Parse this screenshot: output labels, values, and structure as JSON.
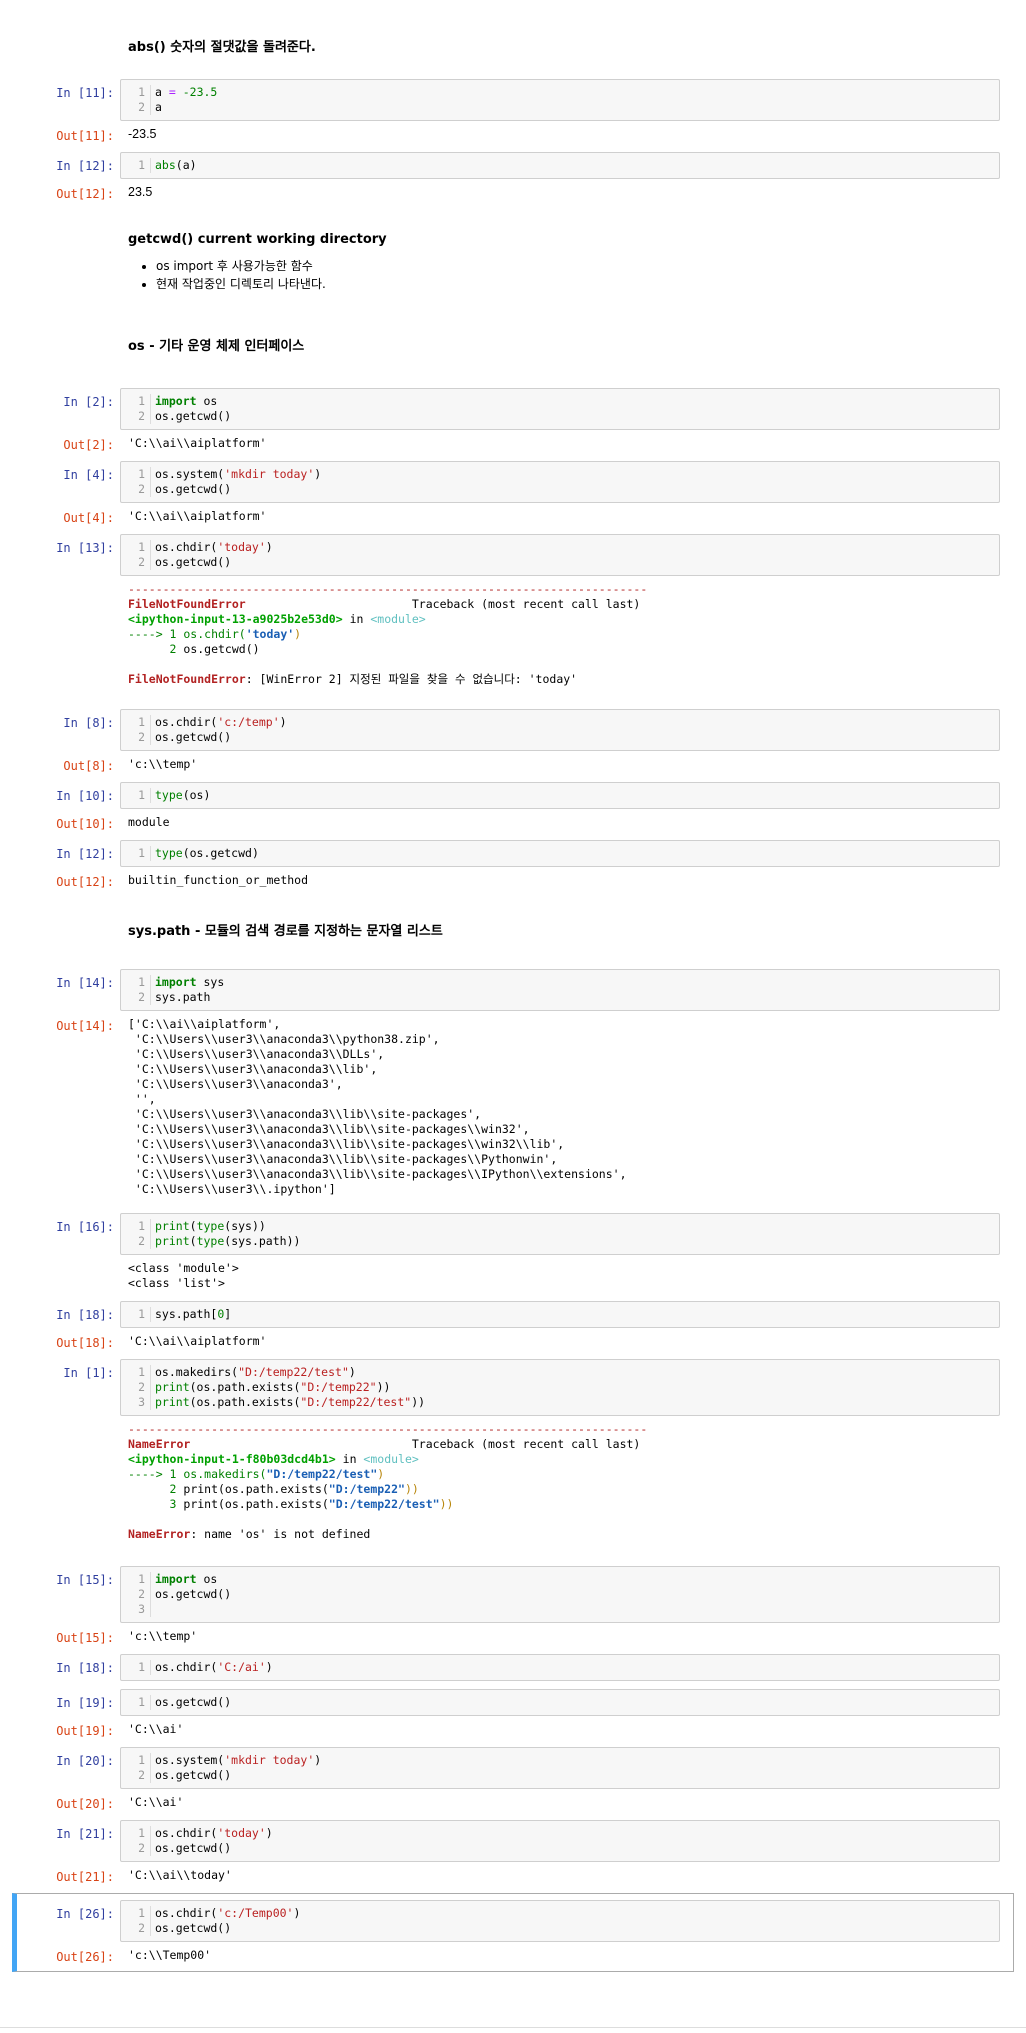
{
  "markdown": {
    "abs_heading": "abs() 숫자의 절댓값을 돌려준다.",
    "getcwd_heading": "getcwd() current working directory",
    "getcwd_bullets": [
      "os import 후 사용가능한 함수",
      "현재 작업중인 디렉토리 나타낸다."
    ],
    "os_heading": "os - 기타 운영 체제 인터페이스",
    "syspath_heading": "sys.path - 모듈의 검색 경로를 지정하는 문자열 리스트"
  },
  "cells": {
    "c11": {
      "in": "In [11]:",
      "out": "Out[11]:",
      "result": "-23.5",
      "gutter": "1\n2"
    },
    "c12a": {
      "in": "In [12]:",
      "out": "Out[12]:",
      "result": "23.5",
      "gutter": "1"
    },
    "c2": {
      "in": "In [2]:",
      "out": "Out[2]:",
      "result": "'C:\\\\ai\\\\aiplatform'",
      "gutter": "1\n2"
    },
    "c4": {
      "in": "In [4]:",
      "out": "Out[4]:",
      "result": "'C:\\\\ai\\\\aiplatform'",
      "gutter": "1\n2"
    },
    "c13": {
      "in": "In [13]:",
      "gutter": "1\n2",
      "dashes": "---------------------------------------------------------------------------",
      "err_name": "FileNotFoundError",
      "traceback_label": "Traceback (most recent call last)",
      "input_ref": "<ipython-input-13-a9025b2e53d0>",
      "in_word": " in ",
      "module_ref": "<module>",
      "arrow_line_prefix": "----> 1 os.chdir(",
      "arrow_line_str": "'today'",
      "arrow_line_suffix": ")",
      "line2_num": "      2 ",
      "line2_code": "os.getcwd()",
      "err_final_name": "FileNotFoundError",
      "err_final_msg": ": [WinError 2] 지정된 파일을 찾을 수 없습니다: 'today'"
    },
    "c8": {
      "in": "In [8]:",
      "out": "Out[8]:",
      "result": "'c:\\\\temp'",
      "gutter": "1\n2"
    },
    "c10": {
      "in": "In [10]:",
      "out": "Out[10]:",
      "result": "module",
      "gutter": "1"
    },
    "c12b": {
      "in": "In [12]:",
      "out": "Out[12]:",
      "result": "builtin_function_or_method",
      "gutter": "1"
    },
    "c14": {
      "in": "In [14]:",
      "out": "Out[14]:",
      "gutter": "1\n2",
      "result": "['C:\\\\ai\\\\aiplatform',\n 'C:\\\\Users\\\\user3\\\\anaconda3\\\\python38.zip',\n 'C:\\\\Users\\\\user3\\\\anaconda3\\\\DLLs',\n 'C:\\\\Users\\\\user3\\\\anaconda3\\\\lib',\n 'C:\\\\Users\\\\user3\\\\anaconda3',\n '',\n 'C:\\\\Users\\\\user3\\\\anaconda3\\\\lib\\\\site-packages',\n 'C:\\\\Users\\\\user3\\\\anaconda3\\\\lib\\\\site-packages\\\\win32',\n 'C:\\\\Users\\\\user3\\\\anaconda3\\\\lib\\\\site-packages\\\\win32\\\\lib',\n 'C:\\\\Users\\\\user3\\\\anaconda3\\\\lib\\\\site-packages\\\\Pythonwin',\n 'C:\\\\Users\\\\user3\\\\anaconda3\\\\lib\\\\site-packages\\\\IPython\\\\extensions',\n 'C:\\\\Users\\\\user3\\\\.ipython']"
    },
    "c16": {
      "in": "In [16]:",
      "gutter": "1\n2",
      "stdout": "<class 'module'>\n<class 'list'>"
    },
    "c18a": {
      "in": "In [18]:",
      "out": "Out[18]:",
      "result": "'C:\\\\ai\\\\aiplatform'",
      "gutter": "1"
    },
    "c1": {
      "in": "In [1]:",
      "gutter": "1\n2\n3",
      "dashes": "---------------------------------------------------------------------------",
      "err_name": "NameError",
      "traceback_label": "Traceback (most recent call last)",
      "input_ref": "<ipython-input-1-f80b03dcd4b1>",
      "in_word": " in ",
      "module_ref": "<module>",
      "line1_prefix": "----> 1 os.makedirs(",
      "line1_str": "\"D:/temp22/test\"",
      "line1_suffix": ")",
      "line2_num": "      2 ",
      "line2_prefix": "print(os.path.exists(",
      "line2_str": "\"D:/temp22\"",
      "line2_suffix": "))",
      "line3_num": "      3 ",
      "line3_prefix": "print(os.path.exists(",
      "line3_str": "\"D:/temp22/test\"",
      "line3_suffix": "))",
      "err_final_name": "NameError",
      "err_final_msg": ": name 'os' is not defined"
    },
    "c15": {
      "in": "In [15]:",
      "out": "Out[15]:",
      "result": "'c:\\\\temp'",
      "gutter": "1\n2\n3"
    },
    "c18b": {
      "in": "In [18]:",
      "gutter": "1"
    },
    "c19": {
      "in": "In [19]:",
      "out": "Out[19]:",
      "result": "'C:\\\\ai'",
      "gutter": "1"
    },
    "c20": {
      "in": "In [20]:",
      "out": "Out[20]:",
      "result": "'C:\\\\ai'",
      "gutter": "1\n2"
    },
    "c21": {
      "in": "In [21]:",
      "out": "Out[21]:",
      "result": "'C:\\\\ai\\\\today'",
      "gutter": "1\n2"
    },
    "c26": {
      "in": "In [26]:",
      "out": "Out[26]:",
      "result": "'c:\\\\Temp00'",
      "gutter": "1\n2"
    }
  },
  "code": {
    "a_var": "a",
    "assign": " = ",
    "neg_num": "-23.5",
    "abs_fn": "abs",
    "abs_arg": "(a)",
    "import_kw": "import",
    "os_mod": " os",
    "sys_mod": " sys",
    "getcwd_call": "os.getcwd()",
    "system_prefix": "os.system(",
    "mkdir_str": "'mkdir today'",
    "close_paren": ")",
    "chdir_prefix": "os.chdir(",
    "today_str": "'today'",
    "ctemp_str": "'c:/temp'",
    "type_fn": "type",
    "type_os_arg": "(os)",
    "type_getcwd_arg": "(os.getcwd)",
    "syspath": "sys.path",
    "print_fn": "print",
    "print_type_sys_mid": "(",
    "print_type_sys_arg": "(sys))",
    "print_type_syspath_arg": "(sys.path))",
    "syspath_index_prefix": "sys.path[",
    "syspath_index_num": "0",
    "syspath_index_suffix": "]",
    "makedirs_prefix": "os.makedirs(",
    "d_test_str": "\"D:/temp22/test\"",
    "d_str": "\"D:/temp22\"",
    "exists_prefix": "(os.path.exists(",
    "exists_suffix": "))",
    "cai_str": "'C:/ai'",
    "ctemp00_str": "'c:/Temp00'"
  }
}
